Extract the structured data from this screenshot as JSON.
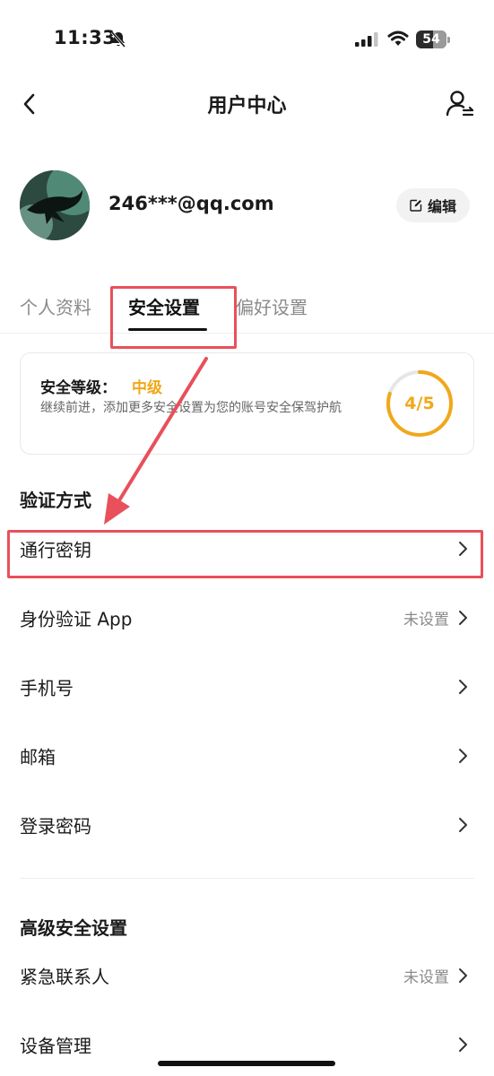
{
  "status_bar": {
    "time": "11:33",
    "battery": "54"
  },
  "nav": {
    "title": "用户中心"
  },
  "profile": {
    "email": "246***@qq.com",
    "edit_label": "编辑"
  },
  "tabs": [
    {
      "label": "个人资料",
      "active": false
    },
    {
      "label": "安全设置",
      "active": true
    },
    {
      "label": "偏好设置",
      "active": false
    }
  ],
  "security_card": {
    "title": "安全等级：",
    "level": "中级",
    "description": "继续前进，添加更多安全设置为您的账号安全保驾护航",
    "score": "4/5",
    "score_value": 4,
    "score_max": 5
  },
  "verification": {
    "title": "验证方式",
    "items": [
      {
        "label": "通行密钥",
        "value": ""
      },
      {
        "label": "身份验证 App",
        "value": "未设置"
      },
      {
        "label": "手机号",
        "value": ""
      },
      {
        "label": "邮箱",
        "value": ""
      },
      {
        "label": "登录密码",
        "value": ""
      }
    ]
  },
  "advanced": {
    "title": "高级安全设置",
    "items": [
      {
        "label": "紧急联系人",
        "value": "未设置"
      },
      {
        "label": "设备管理",
        "value": ""
      }
    ]
  },
  "colors": {
    "accent": "#f0a81a",
    "highlight": "#e8505b"
  }
}
